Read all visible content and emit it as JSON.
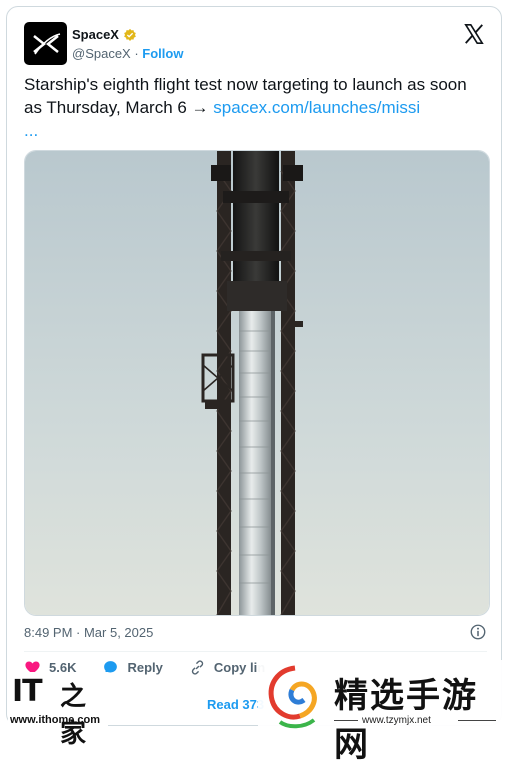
{
  "tweet": {
    "author_name": "SpaceX",
    "author_handle": "@SpaceX",
    "handle_separator": " · ",
    "follow_label": "Follow",
    "text": "Starship's eighth flight test now targeting to launch as soon as Thursday, March 6 → ",
    "link_text": "spacex.com/launches/missi",
    "link_ellipsis": "...",
    "timestamp": "8:49 PM · Mar 5, 2025",
    "likes_count": "5.6K",
    "reply_label": "Reply",
    "copy_link_label": "Copy lin",
    "read_label": "Read 373"
  },
  "watermarks": {
    "ithome_it": "IT",
    "ithome_home": "之家",
    "ithome_url": "www.ithome.com",
    "tzy_title": "精选手游网",
    "tzy_url": "www.tzymjx.net"
  },
  "colors": {
    "accent": "#1d9bf0",
    "like": "#f91880",
    "verified": "#e2b719",
    "text_secondary": "#536471"
  },
  "icons": {
    "verified": "verified-badge-icon",
    "x_logo": "x-logo-icon",
    "info": "info-icon",
    "like": "heart-icon",
    "reply": "reply-bubble-icon",
    "copy": "link-icon"
  }
}
